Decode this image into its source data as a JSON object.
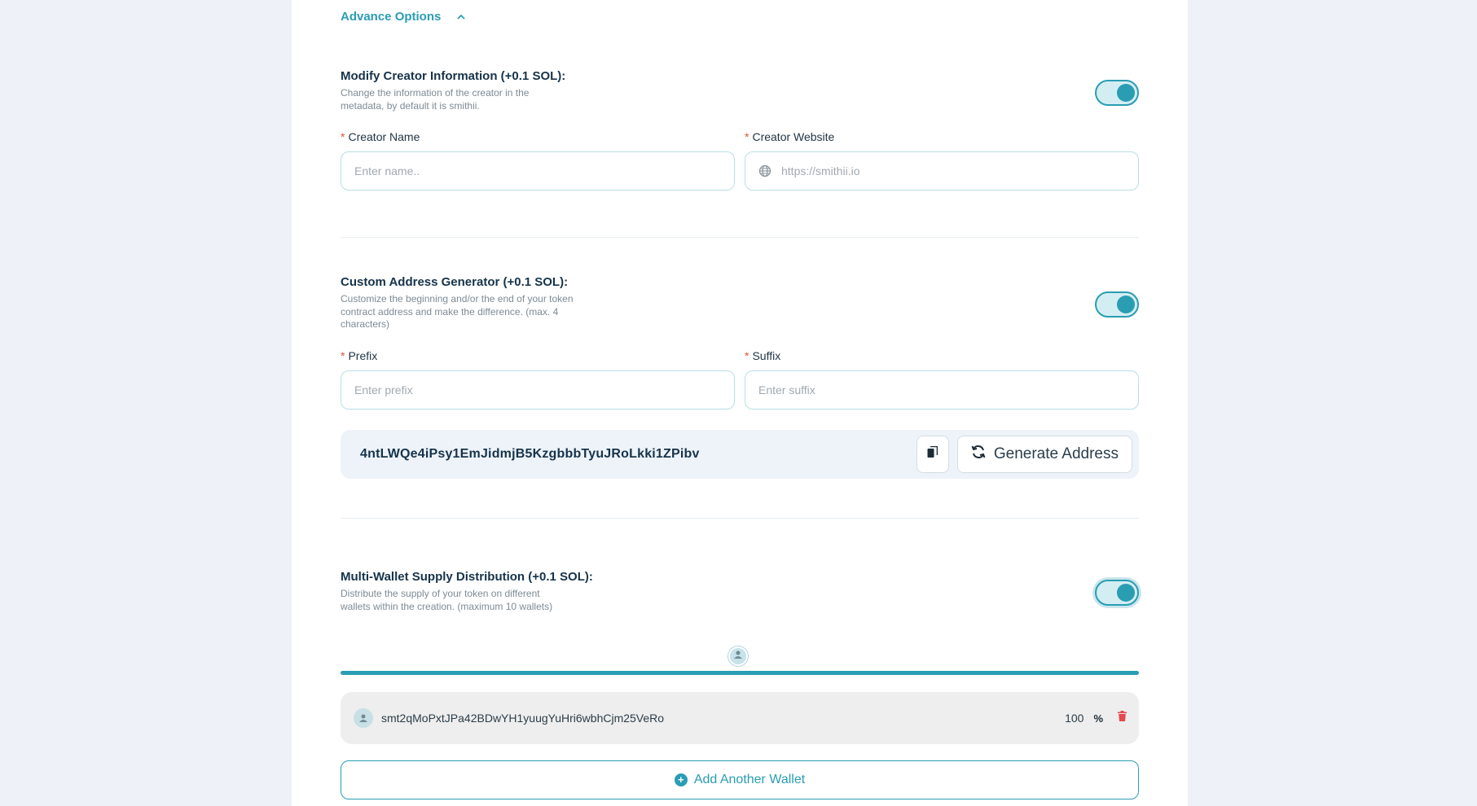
{
  "advanced": {
    "label": "Advance Options"
  },
  "creator": {
    "title": "Modify Creator Information (+0.1 SOL):",
    "desc_line1": "Change the information of the creator in the",
    "desc_line2": "metadata, by default it is smithii.",
    "name_label": "Creator Name",
    "name_placeholder": "Enter name..",
    "website_label": "Creator Website",
    "website_placeholder": "https://smithii.io",
    "enabled": true
  },
  "custom_address": {
    "title": "Custom Address Generator (+0.1 SOL):",
    "desc_line1": "Customize the beginning and/or the end of your token",
    "desc_line2": "contract address and make the difference. (max. 4",
    "desc_line3": "characters)",
    "prefix_label": "Prefix",
    "prefix_placeholder": "Enter prefix",
    "suffix_label": "Suffix",
    "suffix_placeholder": "Enter suffix",
    "generated_address": "4ntLWQe4iPsy1EmJidmjB5KzgbbbTyuJRoLkki1ZPibv",
    "generate_label": "Generate Address",
    "enabled": true
  },
  "multi_wallet": {
    "title": "Multi-Wallet Supply Distribution (+0.1 SOL):",
    "desc_line1": "Distribute the supply of your token on different",
    "desc_line2": "wallets within the creation. (maximum 10 wallets)",
    "enabled": true,
    "wallets": [
      {
        "address": "smt2qMoPxtJPa42BDwYH1yuugYuHri6wbhCjm25VeRo",
        "percent": "100",
        "percent_symbol": "%"
      }
    ],
    "add_label": "Add Another Wallet"
  },
  "colors": {
    "accent": "#2a9db3",
    "required": "#e0533a",
    "danger": "#e5484d"
  }
}
